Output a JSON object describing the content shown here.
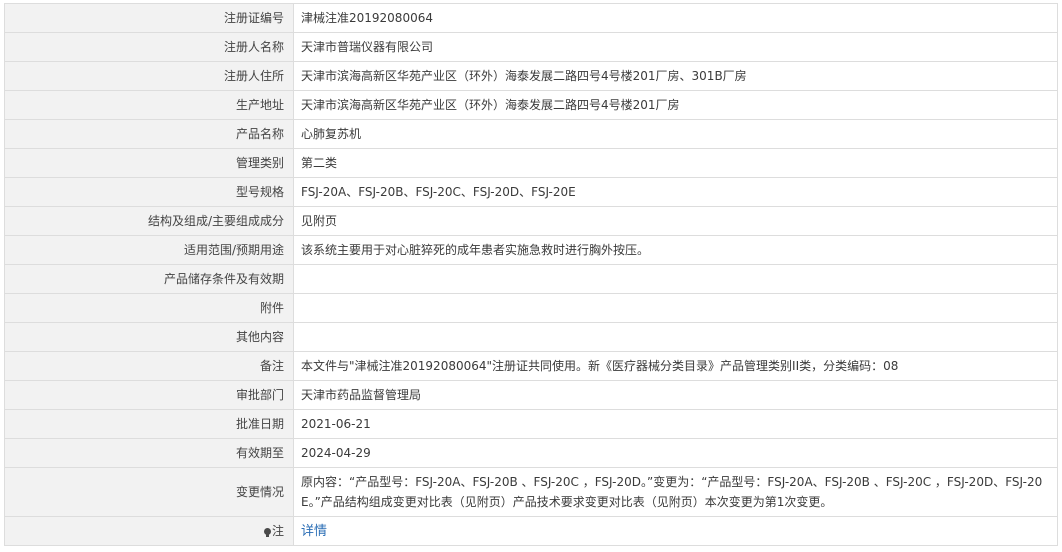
{
  "rows": [
    {
      "label": "注册证编号",
      "value": "津械注准20192080064"
    },
    {
      "label": "注册人名称",
      "value": "天津市普瑞仪器有限公司"
    },
    {
      "label": "注册人住所",
      "value": "天津市滨海高新区华苑产业区（环外）海泰发展二路四号4号楼201厂房、301B厂房"
    },
    {
      "label": "生产地址",
      "value": "天津市滨海高新区华苑产业区（环外）海泰发展二路四号4号楼201厂房"
    },
    {
      "label": "产品名称",
      "value": "心肺复苏机"
    },
    {
      "label": "管理类别",
      "value": "第二类"
    },
    {
      "label": "型号规格",
      "value": "FSJ-20A、FSJ-20B、FSJ-20C、FSJ-20D、FSJ-20E"
    },
    {
      "label": "结构及组成/主要组成成分",
      "value": "见附页"
    },
    {
      "label": "适用范围/预期用途",
      "value": "该系统主要用于对心脏猝死的成年患者实施急救时进行胸外按压。"
    },
    {
      "label": "产品储存条件及有效期",
      "value": ""
    },
    {
      "label": "附件",
      "value": ""
    },
    {
      "label": "其他内容",
      "value": ""
    },
    {
      "label": "备注",
      "value": "本文件与\"津械注准20192080064\"注册证共同使用。新《医疗器械分类目录》产品管理类别II类，分类编码：08"
    },
    {
      "label": "审批部门",
      "value": "天津市药品监督管理局"
    },
    {
      "label": "批准日期",
      "value": "2021-06-21"
    },
    {
      "label": "有效期至",
      "value": "2024-04-29"
    },
    {
      "label": "变更情况",
      "value": "原内容：“产品型号：FSJ-20A、FSJ-20B 、FSJ-20C ，FSJ-20D。”变更为：“产品型号：FSJ-20A、FSJ-20B 、FSJ-20C ，FSJ-20D、FSJ-20E。”产品结构组成变更对比表（见附页）产品技术要求变更对比表（见附页）本次变更为第1次变更。"
    }
  ],
  "note": {
    "label": "注",
    "link_text": "详情"
  }
}
